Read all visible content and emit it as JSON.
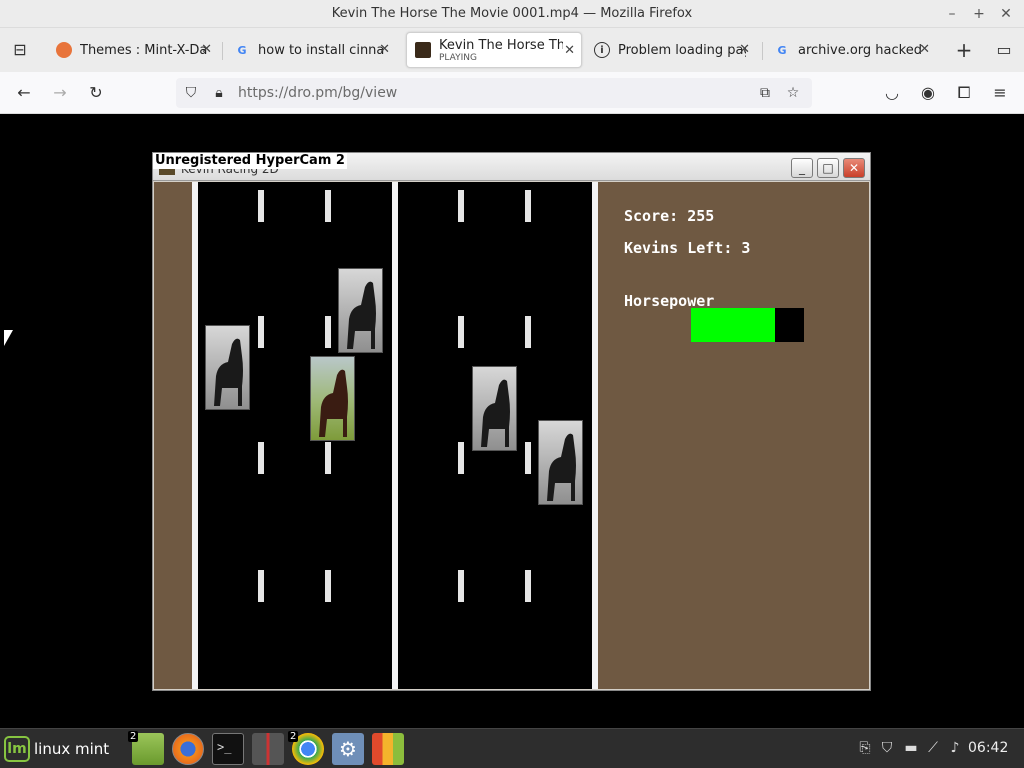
{
  "window": {
    "title": "Kevin The Horse The Movie 0001.mp4 — Mozilla Firefox"
  },
  "tabs": [
    {
      "label": "Themes : Mint-X-Dar",
      "favicon": "orange-circle-icon",
      "active": false
    },
    {
      "label": "how to install cinna",
      "favicon": "google-icon",
      "active": false
    },
    {
      "label": "Kevin The Horse The",
      "sublabel": "PLAYING",
      "favicon": "video-thumbnail-icon",
      "active": true
    },
    {
      "label": "Problem loading pag",
      "favicon": "info-icon",
      "active": false
    },
    {
      "label": "archive.org hacked -",
      "favicon": "google-icon",
      "active": false
    }
  ],
  "navbar": {
    "url": "https://dro.pm/bg/view"
  },
  "video": {
    "watermark": "Unregistered HyperCam 2",
    "game_window_title": "Kevin Racing 2D",
    "score_text": "Score: 255",
    "lives_text": "Kevins Left: 3",
    "horsepower_label": "Horsepower",
    "horsepower_level": 0.74
  },
  "taskbar": {
    "start_label": "linux mint",
    "files_badge": "2",
    "chrome_badge": "2",
    "clock": "06:42"
  },
  "colors": {
    "hp_fill": "#00ff00",
    "side_panel": "#6f5942",
    "mint_green": "#87c541"
  }
}
